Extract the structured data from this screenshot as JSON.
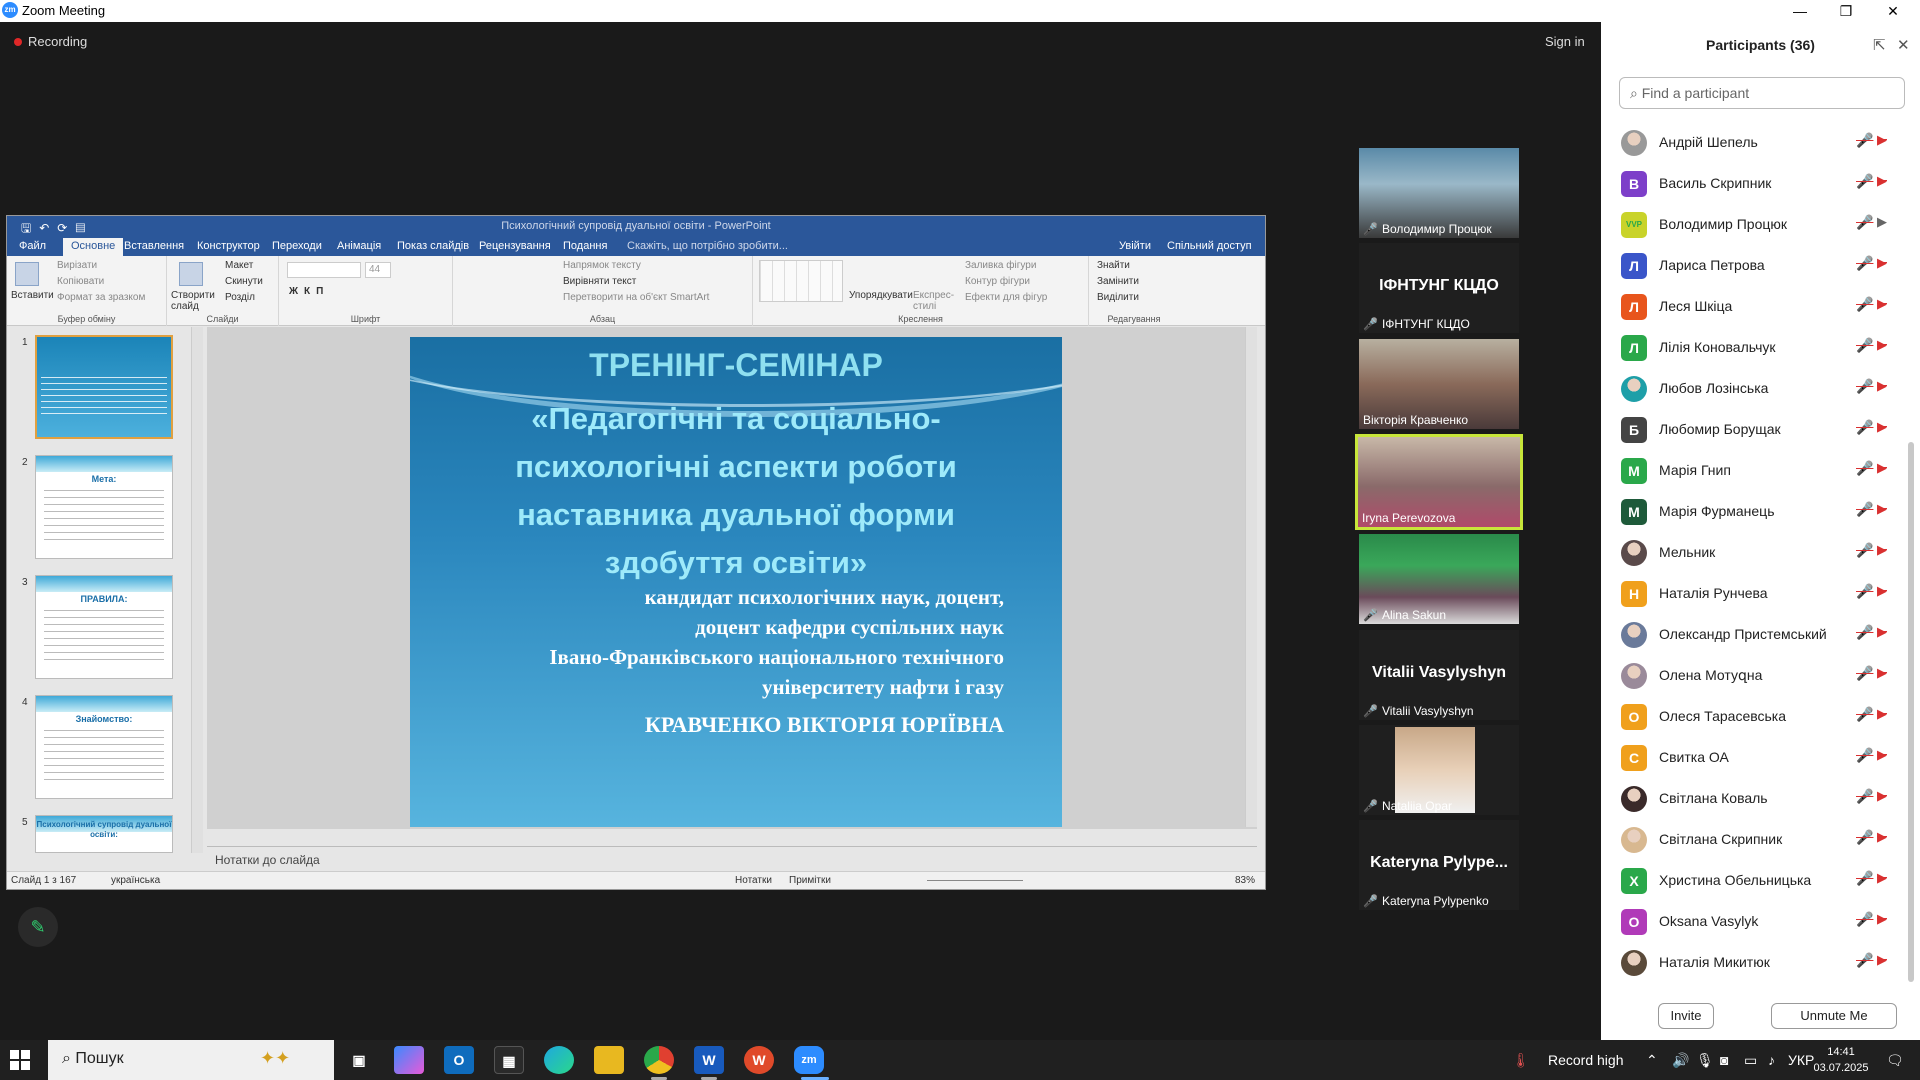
{
  "window": {
    "title": "Zoom Meeting",
    "logo": "zm",
    "min": "—",
    "restore": "❐",
    "close": "✕"
  },
  "meeting": {
    "recording": "Recording",
    "sign_in": "Sign in"
  },
  "ppt": {
    "title": "Психологічний супровід дуальної освіти  -  PowerPoint",
    "tabs": [
      "Файл",
      "Основне",
      "Вставлення",
      "Конструктор",
      "Переходи",
      "Анімація",
      "Показ слайдів",
      "Рецензування",
      "Подання"
    ],
    "tell_me": "Скажіть, що потрібно зробити...",
    "sign_in": "Увійти",
    "share": "Спільний доступ",
    "ribbon": {
      "clipboard": {
        "name": "Буфер обміну",
        "paste": "Вставити",
        "cut": "Вирізати",
        "copy": "Копіювати",
        "format": "Формат за зразком"
      },
      "slides": {
        "name": "Слайди",
        "new": "Створити слайд",
        "layout": "Макет",
        "reset": "Скинути",
        "section": "Розділ"
      },
      "font": {
        "name": "Шрифт",
        "size": "44"
      },
      "paragraph": {
        "name": "Абзац",
        "dir": "Напрямок тексту",
        "align": "Вирівняти текст",
        "smartart": "Перетворити на об'єкт SmartArt"
      },
      "drawing": {
        "name": "Креслення",
        "arrange": "Упорядкувати",
        "quick": "Експрес-стилі",
        "fill": "Заливка фігури",
        "outline": "Контур фігури",
        "effects": "Ефекти для фігур"
      },
      "editing": {
        "name": "Редагування",
        "find": "Знайти",
        "replace": "Замінити",
        "select": "Виділити"
      }
    },
    "thumbs": [
      {
        "num": "1",
        "title": ""
      },
      {
        "num": "2",
        "title": "Мета:"
      },
      {
        "num": "3",
        "title": "ПРАВИЛА:"
      },
      {
        "num": "4",
        "title": "Знайомство:"
      },
      {
        "num": "5",
        "title": "Психологічний супровід дуальної освіти:"
      }
    ],
    "slide": {
      "heading": "ТРЕНІНГ-СЕМІНАР",
      "subtitle": "«Педагогічні та соціально-психологічні аспекти роботи наставника  дуальної форми здобуття освіти»",
      "author1": "кандидат психологічних наук, доцент,",
      "author2": "доцент кафедри суспільних наук",
      "author3": "Івано-Франківського національного технічного",
      "author4": "університету нафти і газу",
      "name": "КРАВЧЕНКО ВІКТОРІЯ ЮРІЇВНА"
    },
    "notes_placeholder": "Нотатки до слайда",
    "status": {
      "slide": "Слайд 1 з 167",
      "lang": "українська",
      "notes": "Нотатки",
      "comments": "Примітки",
      "zoom": "83%"
    }
  },
  "gallery": [
    {
      "name": "Володимир Процюк",
      "big": "",
      "video": true
    },
    {
      "name": "ІФНТУНГ КЦДО",
      "big": "ІФНТУНГ КЦДО",
      "video": false
    },
    {
      "name": "Вікторія Кравченко",
      "big": "",
      "video": true
    },
    {
      "name": "Iryna Perevozova",
      "big": "",
      "video": true
    },
    {
      "name": "Alina Sakun",
      "big": "",
      "video": true
    },
    {
      "name": "Vitalii Vasylyshyn",
      "big": "Vitalii Vasylyshyn",
      "video": false
    },
    {
      "name": "Nataliia Opar",
      "big": "",
      "video": true
    },
    {
      "name": "Kateryna Pylypenko",
      "big": "Kateryna  Pylype...",
      "video": false
    }
  ],
  "participants": {
    "title": "Participants (36)",
    "search_placeholder": "Find a participant",
    "items": [
      {
        "name": "Андрій Шепель",
        "initial": "",
        "color": "#999999",
        "photo": true,
        "cam_on": false
      },
      {
        "name": "Василь Скрипник",
        "initial": "В",
        "color": "#7d3fc9",
        "photo": false,
        "cam_on": false
      },
      {
        "name": "Володимир Процюк",
        "initial": "VVP",
        "color": "#c9d32a",
        "photo": false,
        "cam_on": true
      },
      {
        "name": "Лариса Петрова",
        "initial": "Л",
        "color": "#3a55c9",
        "photo": false,
        "cam_on": false
      },
      {
        "name": "Леся Шкіца",
        "initial": "Л",
        "color": "#e8551c",
        "photo": false,
        "cam_on": false
      },
      {
        "name": "Лілія Коновальчук",
        "initial": "Л",
        "color": "#2aa84a",
        "photo": false,
        "cam_on": false
      },
      {
        "name": "Любов Лозінська",
        "initial": "",
        "color": "#1e9fa8",
        "photo": true,
        "cam_on": false
      },
      {
        "name": "Любомир Борущак",
        "initial": "Б",
        "color": "#444444",
        "photo": false,
        "cam_on": false
      },
      {
        "name": "Марія Гнип",
        "initial": "М",
        "color": "#2aa84a",
        "photo": false,
        "cam_on": false
      },
      {
        "name": "Марія Фурманець",
        "initial": "М",
        "color": "#1e5a3a",
        "photo": false,
        "cam_on": false
      },
      {
        "name": "Мельник",
        "initial": "",
        "color": "#5a4a4a",
        "photo": true,
        "cam_on": false
      },
      {
        "name": "Наталія Рунчева",
        "initial": "Н",
        "color": "#f0a01c",
        "photo": false,
        "cam_on": false
      },
      {
        "name": "Олександр Пристемський",
        "initial": "",
        "color": "#6a7a9a",
        "photo": true,
        "cam_on": false
      },
      {
        "name": "Олена Мотуզна",
        "initial": "",
        "color": "#9a8a9a",
        "photo": true,
        "cam_on": false
      },
      {
        "name": "Олеся Тарасевська",
        "initial": "О",
        "color": "#f0a01c",
        "photo": false,
        "cam_on": false
      },
      {
        "name": "Свитка ОА",
        "initial": "С",
        "color": "#f0a01c",
        "photo": false,
        "cam_on": false
      },
      {
        "name": "Світлана Коваль",
        "initial": "",
        "color": "#3a2a2a",
        "photo": true,
        "cam_on": false
      },
      {
        "name": "Світлана Скрипник",
        "initial": "",
        "color": "#d8b890",
        "photo": true,
        "cam_on": false
      },
      {
        "name": "Христина Обельницька",
        "initial": "Х",
        "color": "#2aa84a",
        "photo": false,
        "cam_on": false
      },
      {
        "name": "Oksana Vasylyk",
        "initial": "O",
        "color": "#b03ab8",
        "photo": false,
        "cam_on": false
      },
      {
        "name": "Наталія Микитюк",
        "initial": "",
        "color": "#5a4a3a",
        "photo": true,
        "cam_on": false
      }
    ],
    "invite": "Invite",
    "unmute": "Unmute Me"
  },
  "taskbar": {
    "search": "Пошук",
    "record": "Record high",
    "lang": "УКР",
    "time": "14:41",
    "date": "03.07.2025"
  },
  "colors": {
    "ppt_blue": "#2b579a",
    "zoom_blue": "#2d8cff",
    "speaking": "#c8e63a",
    "muted": "#d93030"
  }
}
